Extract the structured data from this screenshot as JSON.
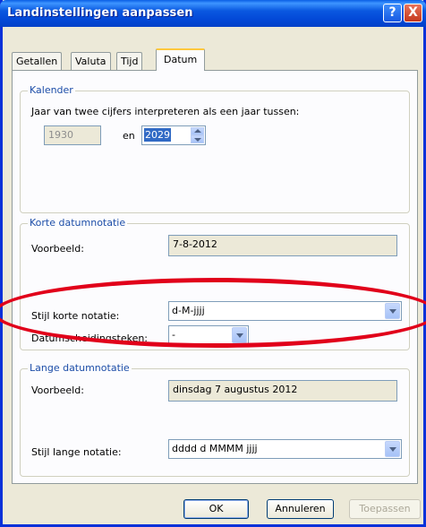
{
  "window": {
    "title": "Landinstellingen aanpassen",
    "help_glyph": "?",
    "close_glyph": "X"
  },
  "tabs": [
    {
      "label": "Getallen"
    },
    {
      "label": "Valuta"
    },
    {
      "label": "Tijd"
    },
    {
      "label": "Datum"
    }
  ],
  "calendar": {
    "legend": "Kalender",
    "description": "Jaar van twee cijfers interpreteren als een jaar tussen:",
    "from_year": "1930",
    "connector": "en",
    "to_year": "2029"
  },
  "short_date": {
    "legend": "Korte datumnotatie",
    "example_label": "Voorbeeld:",
    "example_value": "7-8-2012",
    "style_label": "Stijl korte notatie:",
    "style_value": "d-M-jjjj",
    "separator_label": "Datumscheidingsteken:",
    "separator_value": "-"
  },
  "long_date": {
    "legend": "Lange datumnotatie",
    "example_label": "Voorbeeld:",
    "example_value": "dinsdag 7 augustus 2012",
    "style_label": "Stijl lange notatie:",
    "style_value": "dddd d MMMM jjjj"
  },
  "buttons": {
    "ok": "OK",
    "cancel": "Annuleren",
    "apply": "Toepassen"
  },
  "colors": {
    "title_bar": "#0a58e0",
    "annotation": "#e1001a",
    "legend_text": "#1d4ea8"
  }
}
